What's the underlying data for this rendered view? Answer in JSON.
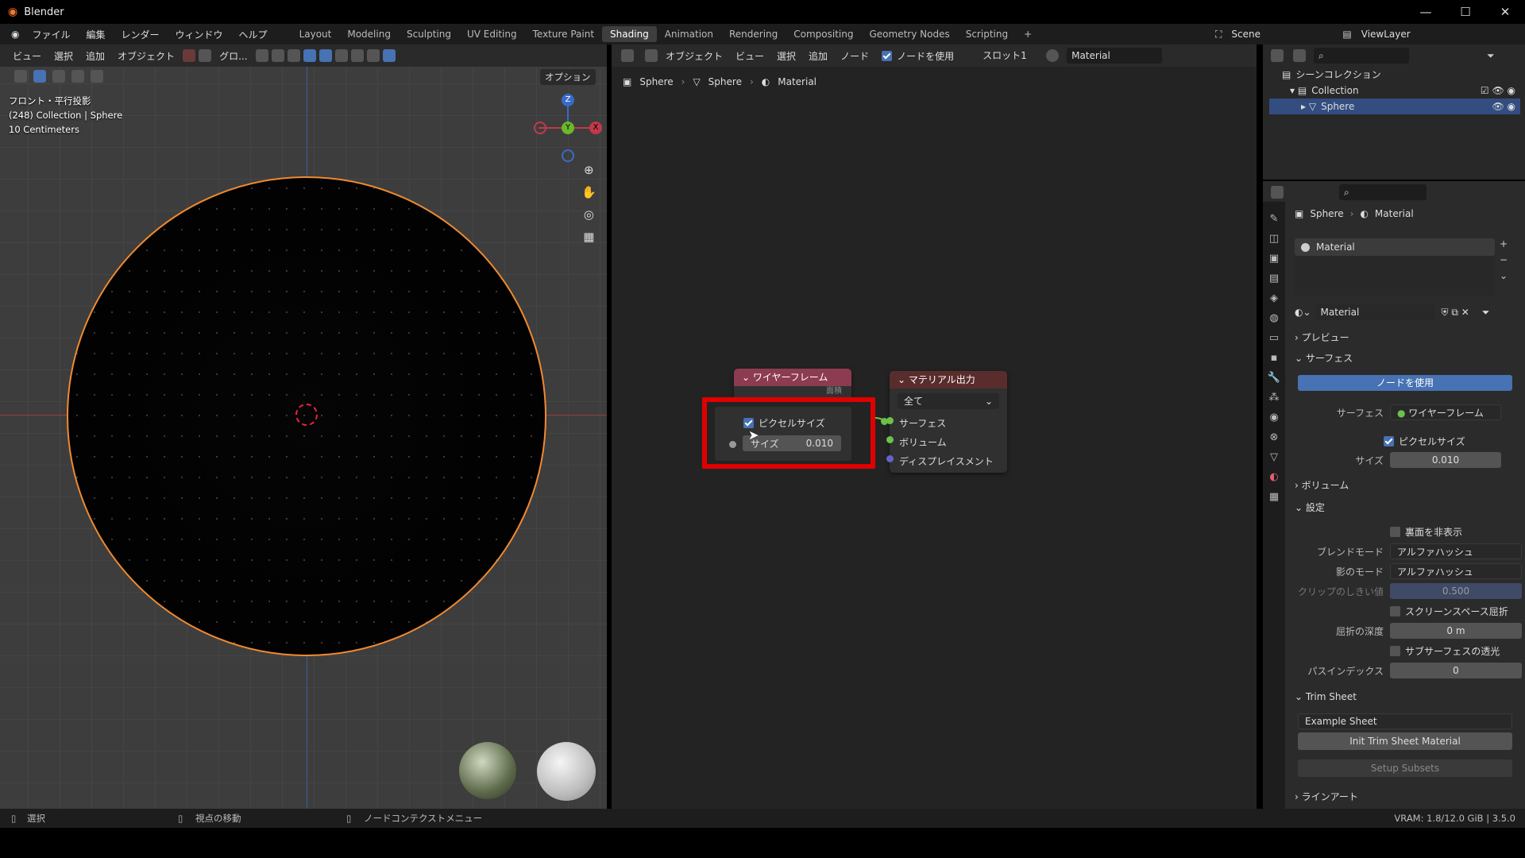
{
  "app": {
    "title": "Blender",
    "min": "—",
    "max": "☐",
    "close": "✕"
  },
  "menu": {
    "items": [
      "ファイル",
      "編集",
      "レンダー",
      "ウィンドウ",
      "ヘルプ"
    ],
    "workspaces": [
      "Layout",
      "Modeling",
      "Sculpting",
      "UV Editing",
      "Texture Paint",
      "Shading",
      "Animation",
      "Rendering",
      "Compositing",
      "Geometry Nodes",
      "Scripting"
    ],
    "active_workspace": "Shading",
    "add_tab": "+",
    "scene": "Scene",
    "view_layer": "ViewLayer"
  },
  "viewport": {
    "menus": [
      "ビュー",
      "選択",
      "追加",
      "オブジェクト"
    ],
    "orientation": "グロ...",
    "options": "オプション",
    "overlay_lines": [
      "フロント・平行投影",
      "(248) Collection | Sphere",
      "10 Centimeters"
    ],
    "gizmo": {
      "z": "Z",
      "y": "Y",
      "x": "X"
    }
  },
  "node_editor": {
    "mode": "オブジェクト",
    "menus": [
      "ビュー",
      "選択",
      "追加",
      "ノード"
    ],
    "use_nodes": "ノードを使用",
    "slot": "スロット1",
    "material": "Material",
    "breadcrumb": [
      "Sphere",
      "Sphere",
      "Material"
    ],
    "wire_node": {
      "title": "ワイヤーフレーム",
      "output": "面積",
      "pixel_size": "ピクセルサイズ",
      "size_label": "サイズ",
      "size_value": "0.010"
    },
    "out_node": {
      "title": "マテリアル出力",
      "target": "全て",
      "inputs": [
        "サーフェス",
        "ボリューム",
        "ディスプレイスメント"
      ]
    }
  },
  "outliner": {
    "root": "シーンコレクション",
    "collection": "Collection",
    "object": "Sphere"
  },
  "props": {
    "breadcrumb": [
      "Sphere",
      "Material"
    ],
    "slot": "Material",
    "datablock": "Material",
    "sections": {
      "preview": "プレビュー",
      "surface": "サーフェス",
      "volume": "ボリューム",
      "settings": "設定",
      "trim": "Trim Sheet",
      "lineart": "ラインアート"
    },
    "use_nodes": "ノードを使用",
    "surface_label": "サーフェス",
    "surface_value": "ワイヤーフレーム",
    "pixel_size": "ピクセルサイズ",
    "size_label": "サイズ",
    "size_value": "0.010",
    "backface": "裏面を非表示",
    "blend_label": "ブレンドモード",
    "blend_value": "アルファハッシュ",
    "shadow_label": "影のモード",
    "shadow_value": "アルファハッシュ",
    "clip_label": "クリップのしきい値",
    "clip_value": "0.500",
    "ssr": "スクリーンスペース屈折",
    "refr_label": "屈折の深度",
    "refr_value": "0 m",
    "sss": "サブサーフェスの透光",
    "pass_label": "パスインデックス",
    "pass_value": "0",
    "trim_sheet": "Example Sheet",
    "init_btn": "Init Trim Sheet Material",
    "setup_btn": "Setup Subsets"
  },
  "status": {
    "select": "選択",
    "rotate": "視点の移動",
    "context": "ノードコンテクストメニュー",
    "vram": "VRAM: 1.8/12.0 GiB | 3.5.0"
  },
  "colors": {
    "accent": "#4772b3",
    "highlight": "#e00000",
    "wire_header": "#8c3b50",
    "output_header": "#5a2d2d",
    "object_outline": "#f08a30"
  }
}
